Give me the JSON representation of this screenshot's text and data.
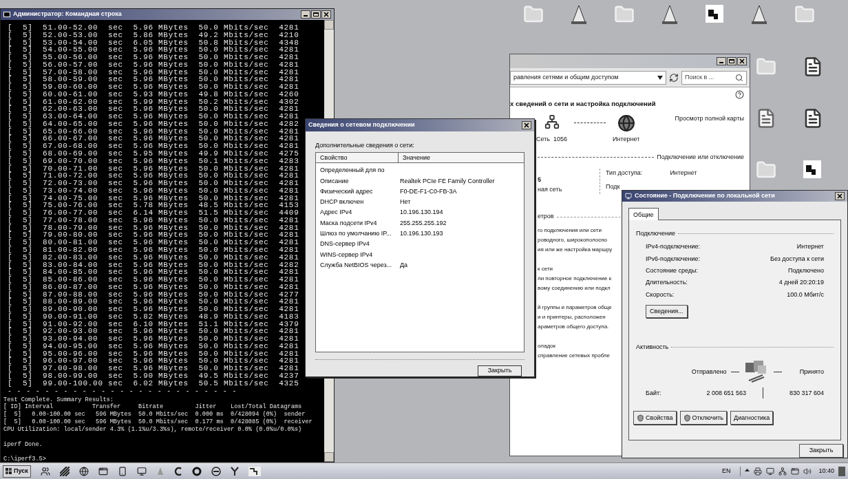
{
  "console": {
    "title": "Администратор: Командная строка",
    "lines": [
      "[  5]  51.00-52.00  sec  5.96 MBytes  50.0 Mbits/sec  4281",
      "[  5]  52.00-53.00  sec  5.86 MBytes  49.2 Mbits/sec  4210",
      "[  5]  53.00-54.00  sec  6.05 MBytes  50.8 Mbits/sec  4348",
      "[  5]  54.00-55.00  sec  5.96 MBytes  50.0 Mbits/sec  4281",
      "[  5]  55.00-56.00  sec  5.96 MBytes  50.0 Mbits/sec  4281",
      "[  5]  56.00-57.00  sec  5.96 MBytes  50.0 Mbits/sec  4281",
      "[  5]  57.00-58.00  sec  5.96 MBytes  50.0 Mbits/sec  4281",
      "[  5]  58.00-59.00  sec  5.96 MBytes  50.0 Mbits/sec  4281",
      "[  5]  59.00-60.00  sec  5.96 MBytes  50.0 Mbits/sec  4281",
      "[  5]  60.00-61.00  sec  5.93 MBytes  49.8 Mbits/sec  4260",
      "[  5]  61.00-62.00  sec  5.99 MBytes  50.2 Mbits/sec  4302",
      "[  5]  62.00-63.00  sec  5.96 MBytes  50.0 Mbits/sec  4281",
      "[  5]  63.00-64.00  sec  5.96 MBytes  50.0 Mbits/sec  4281",
      "[  5]  64.00-65.00  sec  5.96 MBytes  50.0 Mbits/sec  4282",
      "[  5]  65.00-66.00  sec  5.96 MBytes  50.0 Mbits/sec  4281",
      "[  5]  66.00-67.00  sec  5.96 MBytes  50.0 Mbits/sec  4281",
      "[  5]  67.00-68.00  sec  5.96 MBytes  50.0 Mbits/sec  4281",
      "[  5]  68.00-69.00  sec  5.95 MBytes  49.9 Mbits/sec  4275",
      "[  5]  69.00-70.00  sec  5.96 MBytes  50.1 Mbits/sec  4283",
      "[  5]  70.00-71.00  sec  5.96 MBytes  50.0 Mbits/sec  4281",
      "[  5]  71.00-72.00  sec  5.96 MBytes  50.0 Mbits/sec  4281",
      "[  5]  72.00-73.00  sec  5.96 MBytes  50.0 Mbits/sec  4281",
      "[  5]  73.00-74.00  sec  5.96 MBytes  50.0 Mbits/sec  4281",
      "[  5]  74.00-75.00  sec  5.96 MBytes  50.0 Mbits/sec  4281",
      "[  5]  75.00-76.00  sec  5.78 MBytes  48.5 Mbits/sec  4153",
      "[  5]  76.00-77.00  sec  6.14 MBytes  51.5 Mbits/sec  4409",
      "[  5]  77.00-78.00  sec  5.96 MBytes  50.0 Mbits/sec  4281",
      "[  5]  78.00-79.00  sec  5.96 MBytes  50.0 Mbits/sec  4281",
      "[  5]  79.00-80.00  sec  5.96 MBytes  50.0 Mbits/sec  4281",
      "[  5]  80.00-81.00  sec  5.96 MBytes  50.0 Mbits/sec  4281",
      "[  5]  81.00-82.00  sec  5.96 MBytes  50.0 Mbits/sec  4281",
      "[  5]  82.00-83.00  sec  5.96 MBytes  50.0 Mbits/sec  4281",
      "[  5]  83.00-84.00  sec  5.96 MBytes  50.0 Mbits/sec  4282",
      "[  5]  84.00-85.00  sec  5.96 MBytes  50.0 Mbits/sec  4281",
      "[  5]  85.00-86.00  sec  5.96 MBytes  50.0 Mbits/sec  4281",
      "[  5]  86.00-87.00  sec  5.96 MBytes  50.0 Mbits/sec  4281",
      "[  5]  87.00-88.00  sec  5.96 MBytes  50.0 Mbits/sec  4277",
      "[  5]  88.00-89.00  sec  5.96 MBytes  50.0 Mbits/sec  4281",
      "[  5]  89.00-90.00  sec  5.96 MBytes  50.0 Mbits/sec  4281",
      "[  5]  90.00-91.00  sec  5.82 MBytes  48.9 Mbits/sec  4183",
      "[  5]  91.00-92.00  sec  6.10 MBytes  51.1 Mbits/sec  4379",
      "[  5]  92.00-93.00  sec  5.96 MBytes  50.0 Mbits/sec  4281",
      "[  5]  93.00-94.00  sec  5.96 MBytes  50.0 Mbits/sec  4281",
      "[  5]  94.00-95.00  sec  5.96 MBytes  50.0 Mbits/sec  4281",
      "[  5]  95.00-96.00  sec  5.96 MBytes  50.0 Mbits/sec  4281",
      "[  5]  96.00-97.00  sec  5.96 MBytes  50.0 Mbits/sec  4281",
      "[  5]  97.00-98.00  sec  5.96 MBytes  50.0 Mbits/sec  4281",
      "[  5]  98.00-99.00  sec  5.90 MBytes  49.5 Mbits/sec  4237",
      "[  5]  99.00-100.00 sec  6.02 MBytes  50.5 Mbits/sec  4325"
    ],
    "separator": "- - - - - - - - - - - - - - - - - - - - - - - - -",
    "summary": [
      "Test Complete. Summary Results:",
      "[ ID] Interval           Transfer     Bitrate         Jitter    Lost/Total Datagrams",
      "[  5]   0.00-100.00 sec   596 MBytes  50.0 Mbits/sec  0.000 ms  0/428094 (0%)  sender",
      "[  5]   0.00-100.00 sec   596 MBytes  50.0 Mbits/sec  0.177 ms  0/428085 (0%)  receiver",
      "CPU Utilization: local/sender 4.3% (1.1%u/3.3%s), remote/receiver 0.0% (0.0%u/0.0%s)"
    ],
    "done": "iperf Done.",
    "prompt": "C:\\iperf3.5>"
  },
  "network_center": {
    "address": "равления сетями и общим доступом",
    "search": {
      "placeholder": "Поиск в ..."
    },
    "heading": "х сведений о сети и настройка подключений",
    "map": {
      "network": "Сеть  1056",
      "internet": "Интернет",
      "full_map_link": "Просмотр полной карты"
    },
    "section_connect": "Подключение или отключение",
    "left_network": [
      "5",
      "ная сеть"
    ],
    "access": {
      "label": "Тип доступа:",
      "value": "Интернет"
    },
    "connections_label": "Подк",
    "section_change": "етров",
    "tasks": [
      {
        "title": "го подключения или сети",
        "lines": [
          "роводного, широкополосно",
          "ия или же настройка маршру"
        ]
      },
      {
        "title": "к сети",
        "lines": [
          "ли повторное подключение к",
          "вому соединению или подкл"
        ]
      },
      {
        "title": "й группы и параметров обще",
        "lines": [
          "и и принтеры, расположен",
          "араметров общего доступа."
        ]
      },
      {
        "title": "оладок",
        "lines": [
          "справление сетевых пробле"
        ]
      }
    ]
  },
  "dialog": {
    "title": "Сведения о сетевом подключении",
    "caption": "Дополнительные сведения о сети:",
    "columns": [
      "Свойство",
      "Значение"
    ],
    "rows": [
      {
        "property": "Определенный для по"
      },
      {
        "property": "Описание",
        "value": "Realtek PCIe FE Family Controller"
      },
      {
        "property": "Физический адрес",
        "value": "F0-DE-F1-C0-FB-3A"
      },
      {
        "property": "DHCP включен",
        "value": "Нет"
      },
      {
        "property": "Адрес IPv4",
        "value": "10.196.130.194"
      },
      {
        "property": "Маска подсети IPv4",
        "value": "255.255.255.192"
      },
      {
        "property": "Шлюз по умолчанию IP...",
        "value": "10.196.130.193"
      },
      {
        "property": "DNS-сервер IPv4"
      },
      {
        "property": "WINS-сервер IPv4"
      },
      {
        "property": "Служба NetBIOS через...",
        "value": "Да"
      }
    ],
    "button": "Закрыть"
  },
  "status": {
    "title": "Состояние - Подключение по локальной сети",
    "tabs": [
      {
        "label": "Общие",
        "selected": true
      }
    ],
    "connection": {
      "heading": "Подключение",
      "rows": [
        {
          "label": "IPv4-подключение:",
          "value": "Интернет"
        },
        {
          "label": "IPv6-подключение:",
          "value": "Без доступа к сети"
        },
        {
          "label": "Состояние среды:",
          "value": "Подключено"
        },
        {
          "label": "Длительность:",
          "value": "4 дней 20:20:19"
        },
        {
          "label": "Скорость:",
          "value": "100.0 Мбит/с"
        }
      ]
    },
    "details_button": "Сведения...",
    "activity": {
      "heading": "Активность",
      "sent": "Отправлено",
      "received": "Принято",
      "bytes_label": "Байт:",
      "bytes_sent": "2 008 651 563",
      "bytes_received": "830 317 604"
    },
    "buttons": [
      {
        "label": "Свойства",
        "shield": true
      },
      {
        "label": "Отключить",
        "shield": true
      },
      {
        "label": "Диагностика",
        "shield": false
      }
    ],
    "close": "Закрыть"
  },
  "taskbar": {
    "start": "Пуск",
    "language": "EN",
    "clock": "10:40"
  }
}
